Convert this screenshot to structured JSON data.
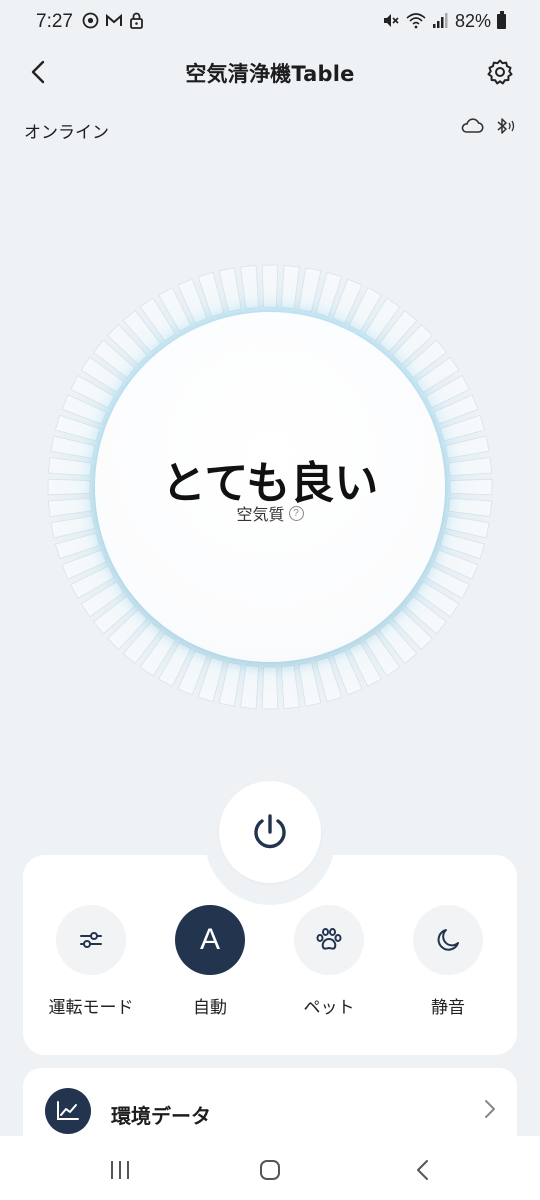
{
  "status_bar": {
    "time": "7:27",
    "left_icons": [
      "sync-icon",
      "gmail-icon",
      "lock-icon"
    ],
    "right_icons": [
      "mute-icon",
      "wifi-icon",
      "signal-icon"
    ],
    "battery": "82%"
  },
  "header": {
    "title": "空気清浄機Table"
  },
  "device": {
    "status": "オンライン"
  },
  "air_quality": {
    "value": "とても良い",
    "label": "空気質",
    "help": "?"
  },
  "modes": [
    {
      "label": "運転モード",
      "icon": "sliders-icon",
      "active": false
    },
    {
      "label": "自動",
      "icon": "auto-icon",
      "active": true,
      "letter": "A"
    },
    {
      "label": "ペット",
      "icon": "paw-icon",
      "active": false
    },
    {
      "label": "静音",
      "icon": "moon-icon",
      "active": false
    }
  ],
  "env_data": {
    "label": "環境データ"
  },
  "colors": {
    "accent_dark": "#23344f",
    "background": "#eef2f5",
    "glow": "#7fd3f0"
  }
}
